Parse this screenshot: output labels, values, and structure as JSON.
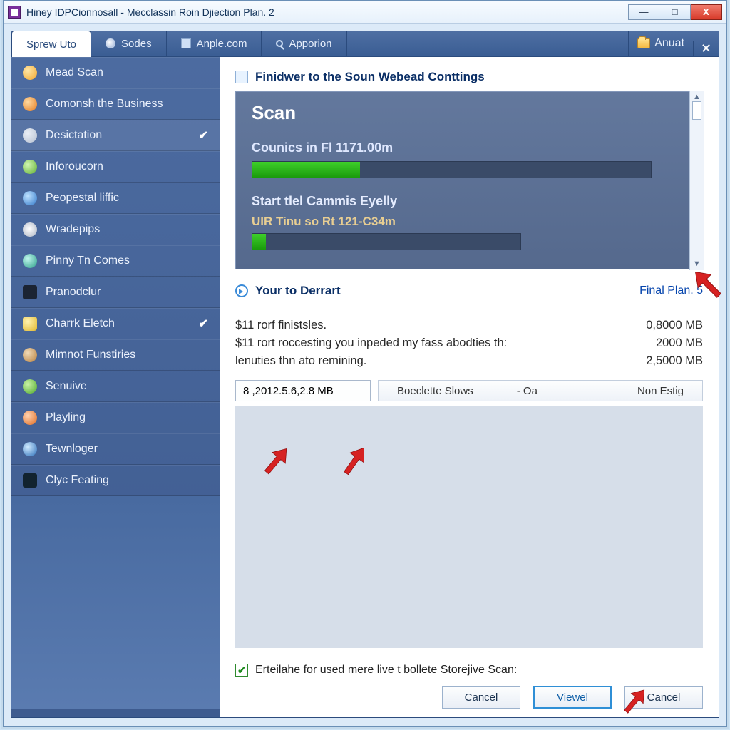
{
  "window": {
    "title": "Hiney IDPCionnosall - Mecclassin Roin Djiection Plan. 2"
  },
  "tabs": {
    "t0": "Sprew Uto",
    "t1": "Sodes",
    "t2": "Anple.com",
    "t3": "Apporion",
    "anuat": "Anuat"
  },
  "sidebar": {
    "i0": "Mead Scan",
    "i1": "Comonsh the Business",
    "i2": "Desictation",
    "i3": "Inforoucorn",
    "i4": "Peopestal liffic",
    "i5": "Wradepips",
    "i6": "Pinny Tn Comes",
    "i7": "Pranodclur",
    "i8": "Charrk Eletch",
    "i9": "Mimnot Funstiries",
    "i10": "Senuive",
    "i11": "Playling",
    "i12": "Tewnloger",
    "i13": "Clyc Feating"
  },
  "main": {
    "section1_title": "Finidwer to the Soun Webead Conttings",
    "scan_header": "Scan",
    "scan_sub1": "Counics in Fl 1171.00m",
    "scan_progress1_pct": 27,
    "scan_sub2": "Start tlel Cammis Eyelly",
    "scan_sub2_line": "UIR Tinu so Rt 121-C34m",
    "scan_progress2_pct": 5,
    "section2_title": "Your to Derrart",
    "section2_right": "Final Plan. 5",
    "d0_l": "$11 rorf finistsles.",
    "d0_r": "0,8000 MB",
    "d1_l": "$11 rort roccesting you inpeded my fass abodties th:",
    "d1_r": "2000 MB",
    "d2_l": "lenuties thn ato remining.",
    "d2_r": "2,5000 MB",
    "field_value": "8 ,2012.5.6,2.8 MB",
    "combo_label": "Boeclette Slows",
    "combo_mid": "-  Oa",
    "combo_right": "Non Estig",
    "checkbox_label": "Erteilahe for used mere live t bollete Storejive Scan:"
  },
  "footer": {
    "cancel1": "Cancel",
    "view": "Viewel",
    "cancel2": "Cancel"
  }
}
